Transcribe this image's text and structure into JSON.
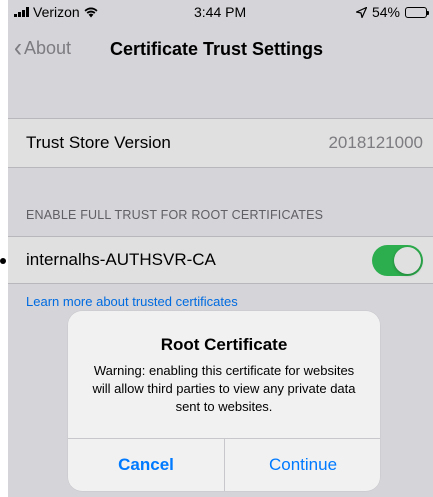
{
  "status": {
    "carrier": "Verizon",
    "time": "3:44 PM",
    "battery_percent": "54%",
    "battery_level": 0.54
  },
  "nav": {
    "back_label": "About",
    "title": "Certificate Trust Settings"
  },
  "trust_store": {
    "label": "Trust Store Version",
    "value": "2018121000"
  },
  "full_trust": {
    "header": "ENABLE FULL TRUST FOR ROOT CERTIFICATES",
    "certificate_name": "internalhs-AUTHSVR-CA",
    "toggle_on": true
  },
  "learn_more": "Learn more about trusted certificates",
  "alert": {
    "title": "Root Certificate",
    "message": "Warning: enabling this certificate for websites will allow third parties to view any private data sent to websites.",
    "cancel_label": "Cancel",
    "continue_label": "Continue"
  },
  "colors": {
    "accent": "#007aff",
    "toggle_on": "#34c759",
    "background": "#f2f2f7"
  }
}
